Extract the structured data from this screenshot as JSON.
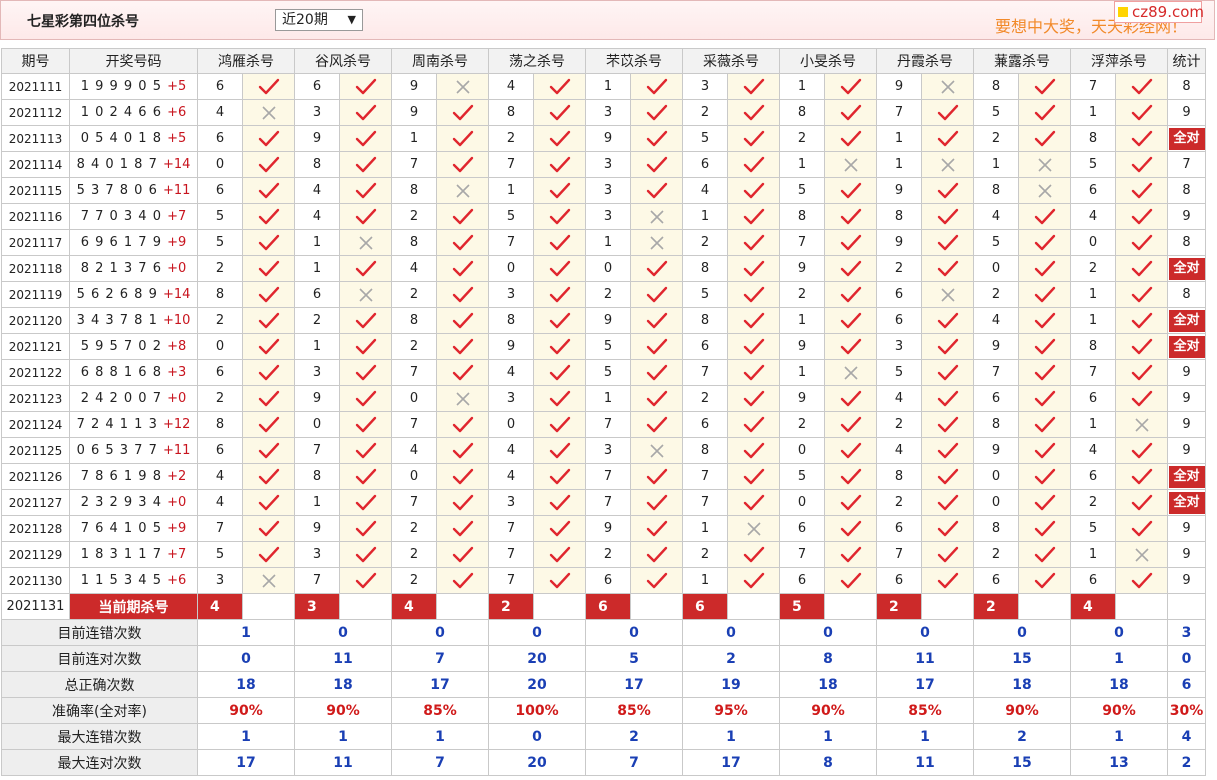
{
  "header": {
    "title": "七星彩第四位杀号",
    "period_select": "近20期",
    "ad_text": "要想中大奖，天天彩经网！",
    "logo_text": "cz89.com"
  },
  "table": {
    "headers": [
      "期号",
      "开奖号码",
      "鸿雁杀号",
      "谷风杀号",
      "周南杀号",
      "荡之杀号",
      "芣苡杀号",
      "采薇杀号",
      "小旻杀号",
      "丹霞杀号",
      "蒹露杀号",
      "浮萍杀号",
      "统计"
    ],
    "rows": [
      {
        "issue": "2021111",
        "draw": "1 9 9 9 0 5",
        "sum": "+5",
        "kills": [
          [
            6,
            1
          ],
          [
            6,
            1
          ],
          [
            9,
            0
          ],
          [
            4,
            1
          ],
          [
            1,
            1
          ],
          [
            3,
            1
          ],
          [
            1,
            1
          ],
          [
            9,
            0
          ],
          [
            8,
            1
          ],
          [
            7,
            1
          ]
        ],
        "stat": "8"
      },
      {
        "issue": "2021112",
        "draw": "1 0 2 4 6 6",
        "sum": "+6",
        "kills": [
          [
            4,
            0
          ],
          [
            3,
            1
          ],
          [
            9,
            1
          ],
          [
            8,
            1
          ],
          [
            3,
            1
          ],
          [
            2,
            1
          ],
          [
            8,
            1
          ],
          [
            7,
            1
          ],
          [
            5,
            1
          ],
          [
            1,
            1
          ]
        ],
        "stat": "9"
      },
      {
        "issue": "2021113",
        "draw": "0 5 4 0 1 8",
        "sum": "+5",
        "kills": [
          [
            6,
            1
          ],
          [
            9,
            1
          ],
          [
            1,
            1
          ],
          [
            2,
            1
          ],
          [
            9,
            1
          ],
          [
            5,
            1
          ],
          [
            2,
            1
          ],
          [
            1,
            1
          ],
          [
            2,
            1
          ],
          [
            8,
            1
          ]
        ],
        "stat": "全对"
      },
      {
        "issue": "2021114",
        "draw": "8 4 0 1 8 7",
        "sum": "+14",
        "kills": [
          [
            0,
            1
          ],
          [
            8,
            1
          ],
          [
            7,
            1
          ],
          [
            7,
            1
          ],
          [
            3,
            1
          ],
          [
            6,
            1
          ],
          [
            1,
            0
          ],
          [
            1,
            0
          ],
          [
            1,
            0
          ],
          [
            5,
            1
          ]
        ],
        "stat": "7"
      },
      {
        "issue": "2021115",
        "draw": "5 3 7 8 0 6",
        "sum": "+11",
        "kills": [
          [
            6,
            1
          ],
          [
            4,
            1
          ],
          [
            8,
            0
          ],
          [
            1,
            1
          ],
          [
            3,
            1
          ],
          [
            4,
            1
          ],
          [
            5,
            1
          ],
          [
            9,
            1
          ],
          [
            8,
            0
          ],
          [
            6,
            1
          ]
        ],
        "stat": "8"
      },
      {
        "issue": "2021116",
        "draw": "7 7 0 3 4 0",
        "sum": "+7",
        "kills": [
          [
            5,
            1
          ],
          [
            4,
            1
          ],
          [
            2,
            1
          ],
          [
            5,
            1
          ],
          [
            3,
            0
          ],
          [
            1,
            1
          ],
          [
            8,
            1
          ],
          [
            8,
            1
          ],
          [
            4,
            1
          ],
          [
            4,
            1
          ]
        ],
        "stat": "9"
      },
      {
        "issue": "2021117",
        "draw": "6 9 6 1 7 9",
        "sum": "+9",
        "kills": [
          [
            5,
            1
          ],
          [
            1,
            0
          ],
          [
            8,
            1
          ],
          [
            7,
            1
          ],
          [
            1,
            0
          ],
          [
            2,
            1
          ],
          [
            7,
            1
          ],
          [
            9,
            1
          ],
          [
            5,
            1
          ],
          [
            0,
            1
          ]
        ],
        "stat": "8"
      },
      {
        "issue": "2021118",
        "draw": "8 2 1 3 7 6",
        "sum": "+0",
        "kills": [
          [
            2,
            1
          ],
          [
            1,
            1
          ],
          [
            4,
            1
          ],
          [
            0,
            1
          ],
          [
            0,
            1
          ],
          [
            8,
            1
          ],
          [
            9,
            1
          ],
          [
            2,
            1
          ],
          [
            0,
            1
          ],
          [
            2,
            1
          ]
        ],
        "stat": "全对"
      },
      {
        "issue": "2021119",
        "draw": "5 6 2 6 8 9",
        "sum": "+14",
        "kills": [
          [
            8,
            1
          ],
          [
            6,
            0
          ],
          [
            2,
            1
          ],
          [
            3,
            1
          ],
          [
            2,
            1
          ],
          [
            5,
            1
          ],
          [
            2,
            1
          ],
          [
            6,
            0
          ],
          [
            2,
            1
          ],
          [
            1,
            1
          ]
        ],
        "stat": "8"
      },
      {
        "issue": "2021120",
        "draw": "3 4 3 7 8 1",
        "sum": "+10",
        "kills": [
          [
            2,
            1
          ],
          [
            2,
            1
          ],
          [
            8,
            1
          ],
          [
            8,
            1
          ],
          [
            9,
            1
          ],
          [
            8,
            1
          ],
          [
            1,
            1
          ],
          [
            6,
            1
          ],
          [
            4,
            1
          ],
          [
            1,
            1
          ]
        ],
        "stat": "全对"
      },
      {
        "issue": "2021121",
        "draw": "5 9 5 7 0 2",
        "sum": "+8",
        "kills": [
          [
            0,
            1
          ],
          [
            1,
            1
          ],
          [
            2,
            1
          ],
          [
            9,
            1
          ],
          [
            5,
            1
          ],
          [
            6,
            1
          ],
          [
            9,
            1
          ],
          [
            3,
            1
          ],
          [
            9,
            1
          ],
          [
            8,
            1
          ]
        ],
        "stat": "全对"
      },
      {
        "issue": "2021122",
        "draw": "6 8 8 1 6 8",
        "sum": "+3",
        "kills": [
          [
            6,
            1
          ],
          [
            3,
            1
          ],
          [
            7,
            1
          ],
          [
            4,
            1
          ],
          [
            5,
            1
          ],
          [
            7,
            1
          ],
          [
            1,
            0
          ],
          [
            5,
            1
          ],
          [
            7,
            1
          ],
          [
            7,
            1
          ]
        ],
        "stat": "9"
      },
      {
        "issue": "2021123",
        "draw": "2 4 2 0 0 7",
        "sum": "+0",
        "kills": [
          [
            2,
            1
          ],
          [
            9,
            1
          ],
          [
            0,
            0
          ],
          [
            3,
            1
          ],
          [
            1,
            1
          ],
          [
            2,
            1
          ],
          [
            9,
            1
          ],
          [
            4,
            1
          ],
          [
            6,
            1
          ],
          [
            6,
            1
          ]
        ],
        "stat": "9"
      },
      {
        "issue": "2021124",
        "draw": "7 2 4 1 1 3",
        "sum": "+12",
        "kills": [
          [
            8,
            1
          ],
          [
            0,
            1
          ],
          [
            7,
            1
          ],
          [
            0,
            1
          ],
          [
            7,
            1
          ],
          [
            6,
            1
          ],
          [
            2,
            1
          ],
          [
            2,
            1
          ],
          [
            8,
            1
          ],
          [
            1,
            0
          ]
        ],
        "stat": "9"
      },
      {
        "issue": "2021125",
        "draw": "0 6 5 3 7 7",
        "sum": "+11",
        "kills": [
          [
            6,
            1
          ],
          [
            7,
            1
          ],
          [
            4,
            1
          ],
          [
            4,
            1
          ],
          [
            3,
            0
          ],
          [
            8,
            1
          ],
          [
            0,
            1
          ],
          [
            4,
            1
          ],
          [
            9,
            1
          ],
          [
            4,
            1
          ]
        ],
        "stat": "9"
      },
      {
        "issue": "2021126",
        "draw": "7 8 6 1 9 8",
        "sum": "+2",
        "kills": [
          [
            4,
            1
          ],
          [
            8,
            1
          ],
          [
            0,
            1
          ],
          [
            4,
            1
          ],
          [
            7,
            1
          ],
          [
            7,
            1
          ],
          [
            5,
            1
          ],
          [
            8,
            1
          ],
          [
            0,
            1
          ],
          [
            6,
            1
          ]
        ],
        "stat": "全对"
      },
      {
        "issue": "2021127",
        "draw": "2 3 2 9 3 4",
        "sum": "+0",
        "kills": [
          [
            4,
            1
          ],
          [
            1,
            1
          ],
          [
            7,
            1
          ],
          [
            3,
            1
          ],
          [
            7,
            1
          ],
          [
            7,
            1
          ],
          [
            0,
            1
          ],
          [
            2,
            1
          ],
          [
            0,
            1
          ],
          [
            2,
            1
          ]
        ],
        "stat": "全对"
      },
      {
        "issue": "2021128",
        "draw": "7 6 4 1 0 5",
        "sum": "+9",
        "kills": [
          [
            7,
            1
          ],
          [
            9,
            1
          ],
          [
            2,
            1
          ],
          [
            7,
            1
          ],
          [
            9,
            1
          ],
          [
            1,
            0
          ],
          [
            6,
            1
          ],
          [
            6,
            1
          ],
          [
            8,
            1
          ],
          [
            5,
            1
          ]
        ],
        "stat": "9"
      },
      {
        "issue": "2021129",
        "draw": "1 8 3 1 1 7",
        "sum": "+7",
        "kills": [
          [
            5,
            1
          ],
          [
            3,
            1
          ],
          [
            2,
            1
          ],
          [
            7,
            1
          ],
          [
            2,
            1
          ],
          [
            2,
            1
          ],
          [
            7,
            1
          ],
          [
            7,
            1
          ],
          [
            2,
            1
          ],
          [
            1,
            0
          ]
        ],
        "stat": "9"
      },
      {
        "issue": "2021130",
        "draw": "1 1 5 3 4 5",
        "sum": "+6",
        "kills": [
          [
            3,
            0
          ],
          [
            7,
            1
          ],
          [
            2,
            1
          ],
          [
            7,
            1
          ],
          [
            6,
            1
          ],
          [
            1,
            1
          ],
          [
            6,
            1
          ],
          [
            6,
            1
          ],
          [
            6,
            1
          ],
          [
            6,
            1
          ]
        ],
        "stat": "9"
      }
    ],
    "current": {
      "issue": "2021131",
      "label": "当前期杀号",
      "kills": [
        "4",
        "3",
        "4",
        "2",
        "6",
        "6",
        "5",
        "2",
        "2",
        "4"
      ]
    },
    "summary": [
      {
        "label": "目前连错次数",
        "values": [
          "1",
          "0",
          "0",
          "0",
          "0",
          "0",
          "0",
          "0",
          "0",
          "0"
        ],
        "stat": "3",
        "red": false
      },
      {
        "label": "目前连对次数",
        "values": [
          "0",
          "11",
          "7",
          "20",
          "5",
          "2",
          "8",
          "11",
          "15",
          "1"
        ],
        "stat": "0",
        "red": false
      },
      {
        "label": "总正确次数",
        "values": [
          "18",
          "18",
          "17",
          "20",
          "17",
          "19",
          "18",
          "17",
          "18",
          "18"
        ],
        "stat": "6",
        "red": false
      },
      {
        "label": "准确率(全对率)",
        "values": [
          "90%",
          "90%",
          "85%",
          "100%",
          "85%",
          "95%",
          "90%",
          "85%",
          "90%",
          "90%"
        ],
        "stat": "30%",
        "red": true
      },
      {
        "label": "最大连错次数",
        "values": [
          "1",
          "1",
          "1",
          "0",
          "2",
          "1",
          "1",
          "1",
          "2",
          "1"
        ],
        "stat": "4",
        "red": false
      },
      {
        "label": "最大连对次数",
        "values": [
          "17",
          "11",
          "7",
          "20",
          "7",
          "17",
          "8",
          "11",
          "15",
          "13"
        ],
        "stat": "2",
        "red": false
      }
    ]
  },
  "colors": {
    "tick": "#e0262e",
    "cross": "#a8a8a8",
    "accent_red": "#cc2a2a",
    "stat_blue": "#1a3fb4"
  },
  "icons": {
    "correct": "check-icon",
    "wrong": "cross-icon"
  }
}
